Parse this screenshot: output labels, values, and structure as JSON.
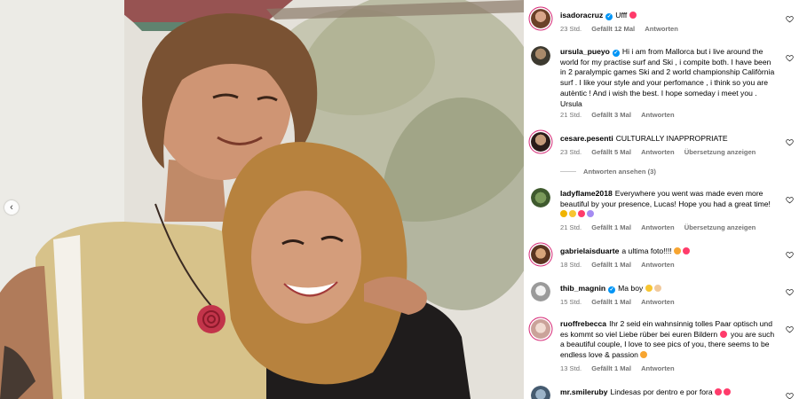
{
  "photo": {
    "alt_icon": "chevron-left-icon",
    "nav_prev_glyph": "‹"
  },
  "comments": [
    {
      "username": "isadoracruz",
      "verified": true,
      "text": "Ufff",
      "emojis": [
        "heart-emoji"
      ],
      "time": "23 Std.",
      "likes": "Gefällt 12 Mal",
      "reply": "Antworten",
      "avatar_color": "#b07a5a"
    },
    {
      "username": "ursula_pueyo",
      "verified": true,
      "text": "Hi i am from Mallorca but i live around the world for my practise surf and Ski , i compite both. I have been in 2 paralympic games Ski and 2 world championship Califòrnia surf . I like your style and your perfomance , i think so you are autèntic ! And i wish the best. I hope someday i meet you . Ursula",
      "time": "21 Std.",
      "likes": "Gefällt 3 Mal",
      "reply": "Antworten",
      "avatar_color": "#5a4a3a"
    },
    {
      "username": "cesare.pesenti",
      "verified": false,
      "text": "CULTURALLY INAPPROPRIATE",
      "time": "23 Std.",
      "likes": "Gefällt 5 Mal",
      "reply": "Antworten",
      "translate": "Übersetzung anzeigen",
      "view_replies": "Antworten ansehen (3)",
      "avatar_color": "#3b2a2a"
    },
    {
      "username": "ladyflame2018",
      "verified": false,
      "text": "Everywhere you went was made even more beautiful by your presence, Lucas! Hope you had a great time!",
      "emojis": [
        "thumbs-up-emoji",
        "smile-emoji",
        "heart-emoji",
        "sparkles-emoji"
      ],
      "time": "21 Std.",
      "likes": "Gefällt 1 Mal",
      "reply": "Antworten",
      "translate": "Übersetzung anzeigen",
      "avatar_color": "#4d6b3a"
    },
    {
      "username": "gabrielaisduarte",
      "verified": false,
      "text": "a ultima foto!!!!",
      "emojis": [
        "heart-eyes-emoji",
        "heart-emoji"
      ],
      "time": "18 Std.",
      "likes": "Gefällt 1 Mal",
      "reply": "Antworten",
      "avatar_color": "#c99a6a"
    },
    {
      "username": "thib_magnin",
      "verified": true,
      "text": "Ma boy",
      "emojis": [
        "smile-emoji",
        "hand-emoji"
      ],
      "time": "15 Std.",
      "likes": "Gefällt 1 Mal",
      "reply": "Antworten",
      "avatar_color": "#d8d8d8"
    },
    {
      "username": "ruoffrebecca",
      "verified": false,
      "text": "Ihr 2 seid ein wahnsinnig tolles Paar optisch und es kommt so viel Liebe rüber bei euren Bildern",
      "text2": "you are such a beautiful couple, I love to see pics of you, there seems to be endless love & passion",
      "emojis": [
        "heart-emoji"
      ],
      "emojis2": [
        "heart-eyes-emoji"
      ],
      "time": "13 Std.",
      "likes": "Gefällt 1 Mal",
      "reply": "Antworten",
      "avatar_color": "#e8c9c0"
    },
    {
      "username": "mr.smileruby",
      "verified": false,
      "text": "Lindesas por dentro e por fora",
      "emojis": [
        "heart-emoji",
        "heart-emoji"
      ],
      "avatar_color": "#6a86a0"
    }
  ],
  "colors": {
    "verified": "#0095f6",
    "story_ring": "#d62976",
    "meta": "#737373",
    "emoji_heart": "#ff3b6b"
  }
}
